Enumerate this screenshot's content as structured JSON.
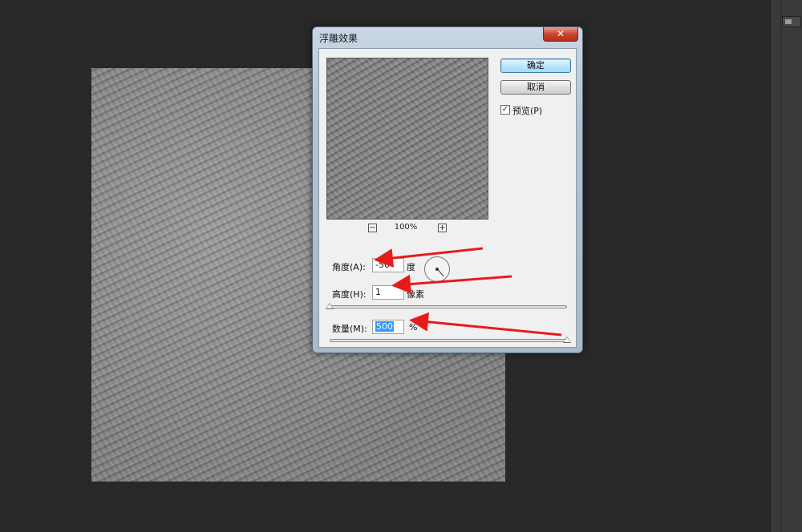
{
  "dialog": {
    "title": "浮雕效果",
    "close_label": "✕",
    "ok_label": "确定",
    "cancel_label": "取消",
    "preview_checkbox": {
      "label": "预览(P)",
      "checked": true
    },
    "zoom": {
      "minus": "−",
      "level": "100%",
      "plus": "+"
    },
    "angle": {
      "label": "角度(A):",
      "value": "-50",
      "unit": "度"
    },
    "height": {
      "label": "高度(H):",
      "value": "1",
      "unit": "像素",
      "slider_fraction": 0.0
    },
    "amount": {
      "label": "数量(M):",
      "value": "500",
      "unit": "%",
      "slider_fraction": 1.0
    }
  },
  "colors": {
    "workspace": "#282828",
    "annotation_arrow": "#e81b1b",
    "selection": "#3399ff"
  },
  "icons": {
    "close": "close-icon",
    "zoom_out": "zoom-out-icon",
    "zoom_in": "zoom-in-icon",
    "checkmark": "checkmark-icon"
  }
}
